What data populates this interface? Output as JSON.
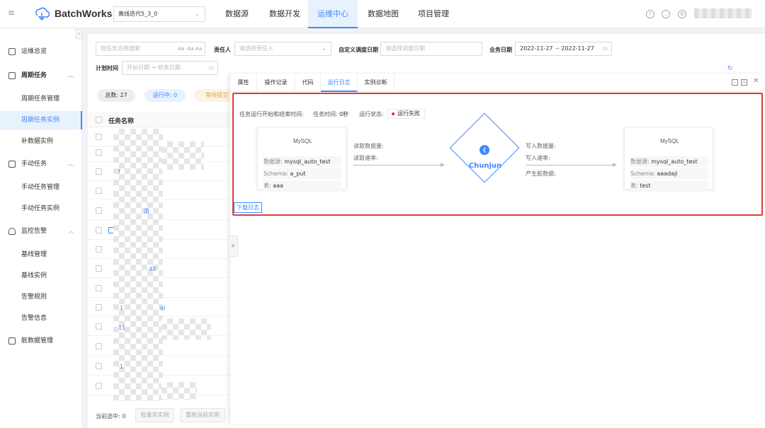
{
  "app": {
    "brand": "BatchWorks",
    "project": "离线迭代5_3_0"
  },
  "nav": [
    "数据源",
    "数据开发",
    "运维中心",
    "数据地图",
    "项目管理"
  ],
  "sidebar": {
    "items": [
      {
        "label": "运维总览",
        "type": "top"
      },
      {
        "label": "周期任务",
        "type": "group"
      },
      {
        "label": "周期任务管理",
        "type": "sub"
      },
      {
        "label": "周期任务实例",
        "type": "sub",
        "active": true
      },
      {
        "label": "补数据实例",
        "type": "sub"
      },
      {
        "label": "手动任务",
        "type": "group"
      },
      {
        "label": "手动任务管理",
        "type": "sub"
      },
      {
        "label": "手动任务实例",
        "type": "sub"
      },
      {
        "label": "监控告警",
        "type": "group"
      },
      {
        "label": "基线管理",
        "type": "sub"
      },
      {
        "label": "基线实例",
        "type": "sub"
      },
      {
        "label": "告警规则",
        "type": "sub"
      },
      {
        "label": "告警信息",
        "type": "sub"
      },
      {
        "label": "脏数据管理",
        "type": "top"
      }
    ]
  },
  "filters": {
    "search_placeholder": "按任务名称搜索",
    "owner_label": "责任人",
    "owner_placeholder": "请选择责任人",
    "custom_date_label": "自定义调度日期",
    "custom_date_placeholder": "请选择调度日期",
    "biz_date_label": "业务日期",
    "biz_date_start": "2022-11-27",
    "biz_date_end": "2022-11-27",
    "plan_time_label": "计划时间",
    "plan_start_placeholder": "开始日期",
    "plan_end_placeholder": "结束日期"
  },
  "stats": {
    "total": "总数: 27",
    "running": "运行中: 0",
    "waiting": "等待提交"
  },
  "table": {
    "col_name": "任务名称",
    "visible_fragments": [
      "f",
      "流",
      "40",
      "1",
      "ql",
      "11",
      "1"
    ]
  },
  "bottom": {
    "selected": "当前选中: 0",
    "btn_batch": "批量杀实例",
    "btn_rerun": "重跑当前实例"
  },
  "drawer": {
    "tabs": [
      "属性",
      "操作记录",
      "代码",
      "运行日志",
      "实例诊断"
    ],
    "active_tab": "运行日志",
    "meta": {
      "time_label": "任务运行开始和结束时间:",
      "duration_label": "任务时间:",
      "duration_value": "0秒",
      "status_label": "运行状态:",
      "status_value": "运行失败"
    },
    "source": {
      "db_logo": "MySQL",
      "datasource_key": "数据源:",
      "datasource": "mysql_auto_test",
      "schema_key": "Schema:",
      "schema": "a_put",
      "table_key": "表:",
      "table": "aaa"
    },
    "read": {
      "count_label": "读取数据量:",
      "rate_label": "读取速率:"
    },
    "engine": "Chunjun",
    "write": {
      "count_label": "写入数据量:",
      "rate_label": "写入速率:",
      "dirty_label": "产生脏数据:"
    },
    "target": {
      "db_logo": "MySQL",
      "datasource_key": "数据源:",
      "datasource": "mysql_auto_test",
      "schema_key": "Schema:",
      "schema": "aaadaji",
      "table_key": "表:",
      "table": "test"
    },
    "download_label": "下载日志"
  },
  "colors": {
    "accent": "#3f87ff",
    "highlight_border": "#e03a3a",
    "status_fail": "#f5222d"
  }
}
